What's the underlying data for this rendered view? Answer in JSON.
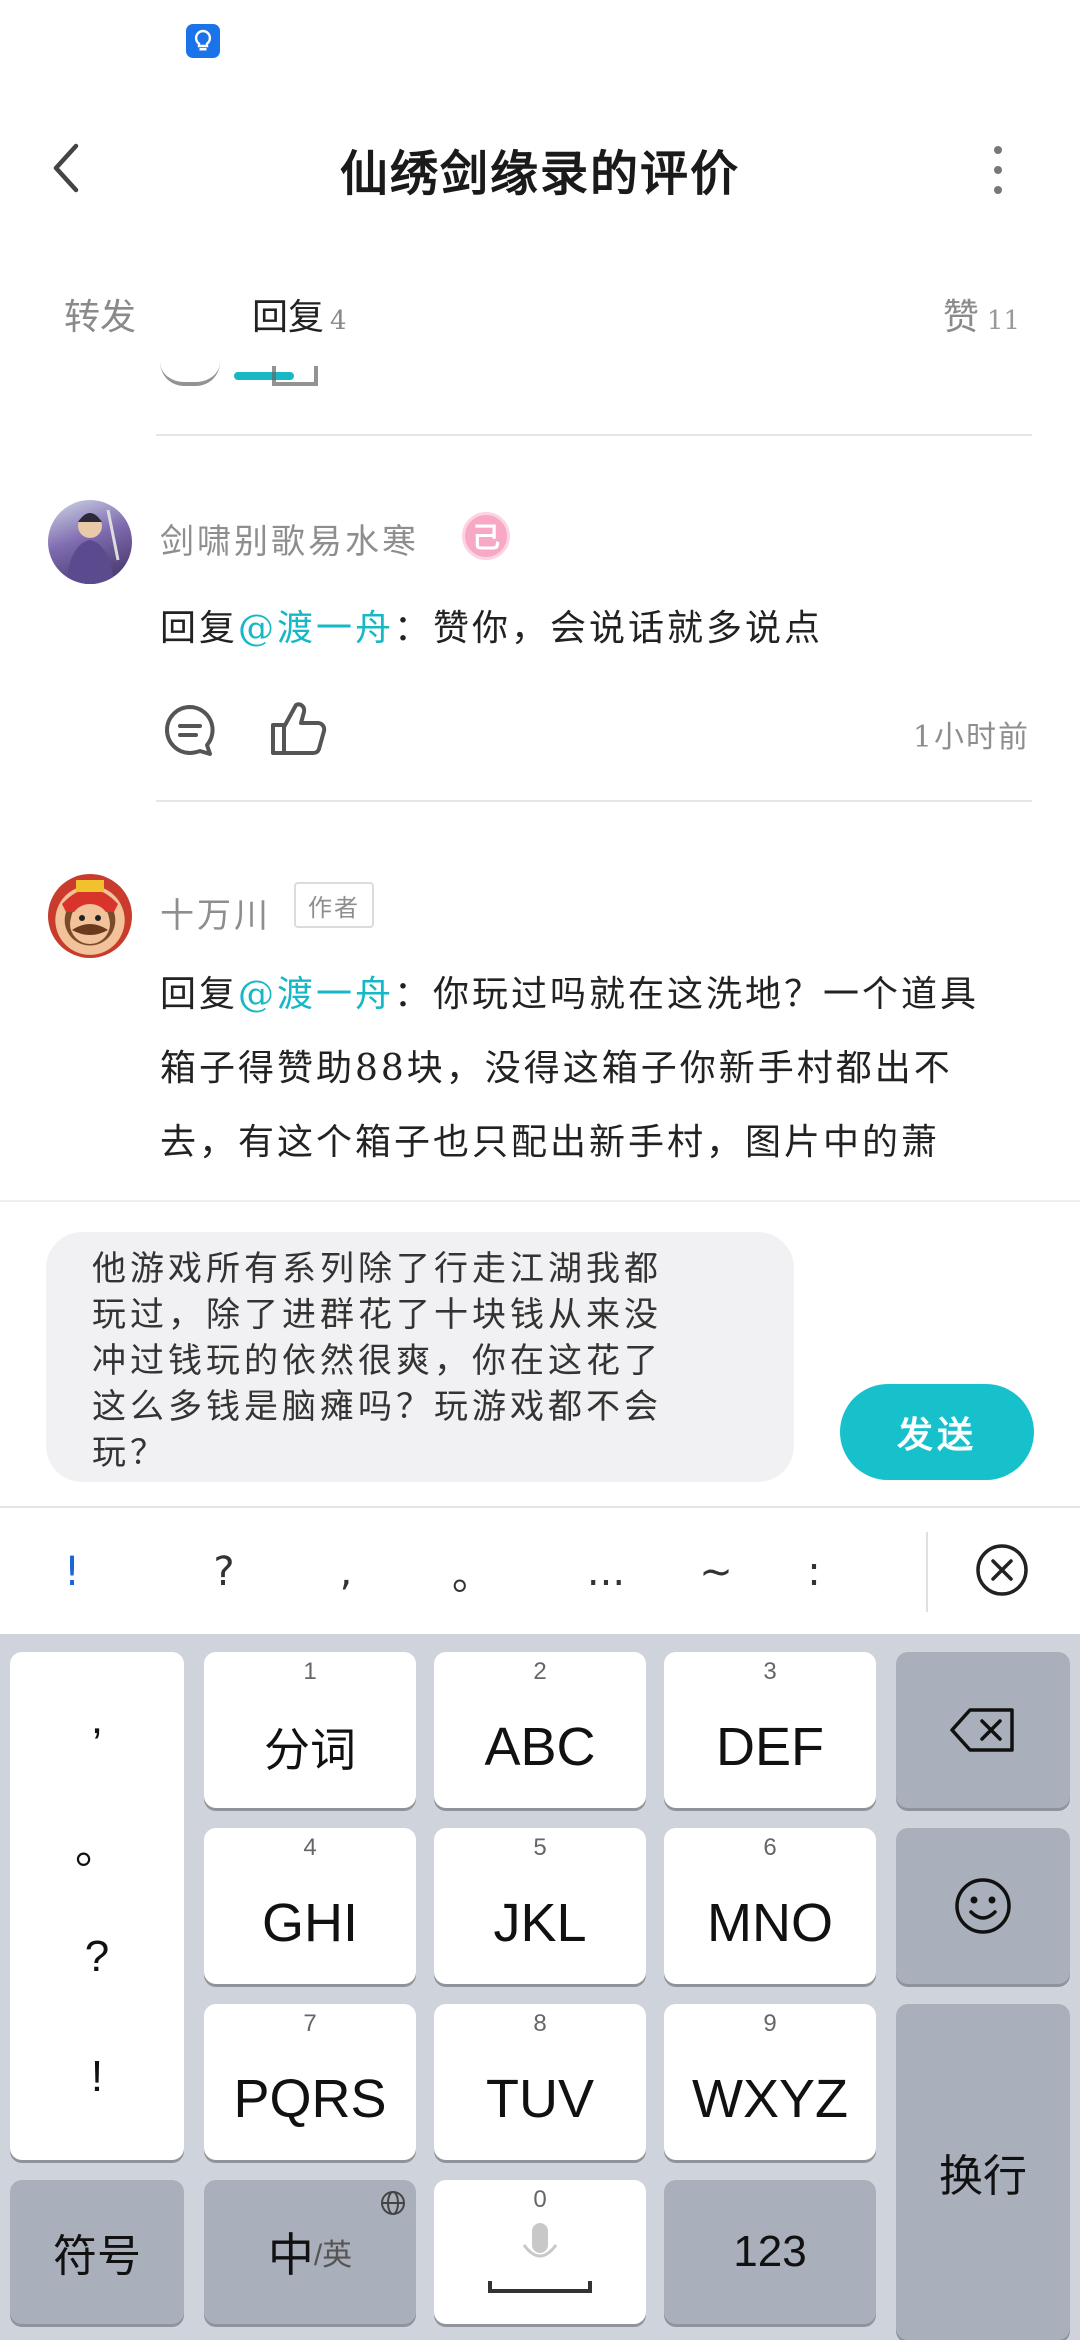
{
  "header": {
    "title": "仙绣剑缘录的评价"
  },
  "tabs": [
    {
      "label": "转发"
    },
    {
      "label": "回复",
      "count": "4"
    },
    {
      "label": "赞",
      "count": "11"
    }
  ],
  "comments": [
    {
      "username": "剑啸别歌易水寒",
      "badge": "己",
      "prefix": "回复",
      "mention": "@渡一舟",
      "text": "：赞你，会说话就多说点",
      "time": "1小时前"
    },
    {
      "username": "十万川",
      "tag": "作者",
      "prefix": "回复",
      "mention": "@渡一舟",
      "line1": "：你玩过吗就在这洗地？一个道具",
      "line2": "箱子得赞助88块，没得这箱子你新手村都出不",
      "line3": "去，有这个箱子也只配出新手村，图片中的萧"
    }
  ],
  "reply": {
    "draft_lines": [
      "他游戏所有系列除了行走江湖我都",
      "玩过，除了进群花了十块钱从来没",
      "冲过钱玩的依然很爽，你在这花了",
      "这么多钱是脑瘫吗？玩游戏都不会",
      "玩？"
    ],
    "send_label": "发送"
  },
  "punctuation": [
    "!",
    "?",
    ",",
    "。",
    "...",
    "~",
    ":"
  ],
  "keyboard": {
    "left_column": [
      ",",
      "。",
      "?",
      "!"
    ],
    "keys": [
      {
        "num": "1",
        "label": "分词"
      },
      {
        "num": "2",
        "label": "ABC"
      },
      {
        "num": "3",
        "label": "DEF"
      },
      {
        "num": "4",
        "label": "GHI"
      },
      {
        "num": "5",
        "label": "JKL"
      },
      {
        "num": "6",
        "label": "MNO"
      },
      {
        "num": "7",
        "label": "PQRS"
      },
      {
        "num": "8",
        "label": "TUV"
      },
      {
        "num": "9",
        "label": "WXYZ"
      }
    ],
    "symbols_label": "符号",
    "lang_main": "中",
    "lang_sub": "/英",
    "space_num": "0",
    "numbers_label": "123",
    "enter_label": "换行"
  }
}
